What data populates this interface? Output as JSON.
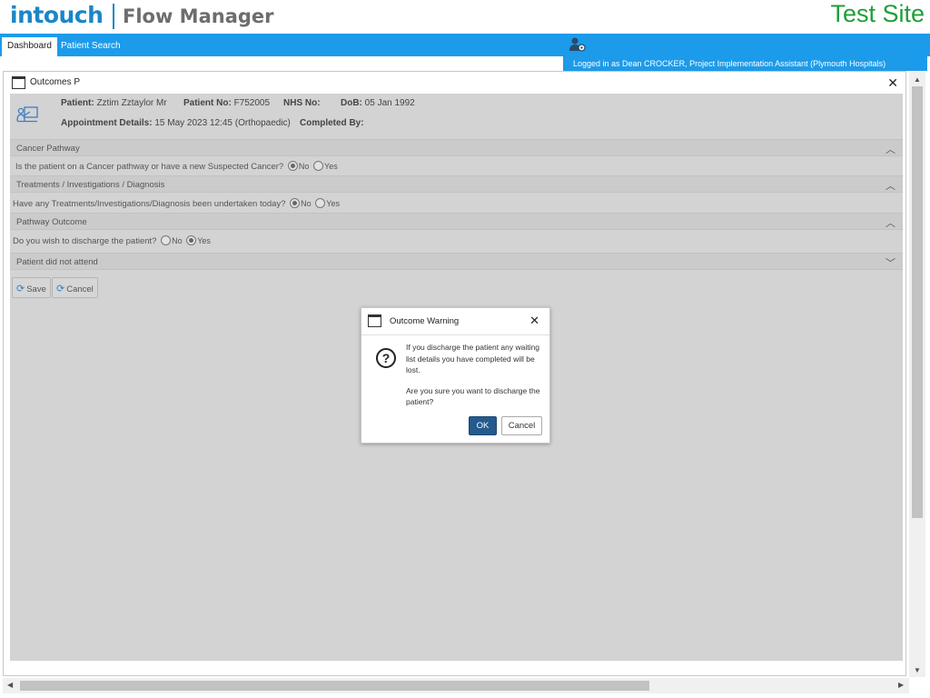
{
  "header": {
    "logo_intouch": "intouch",
    "logo_product": "Flow Manager",
    "site_label": "Test Site"
  },
  "nav": {
    "tabs": [
      {
        "label": "Dashboard",
        "active": true
      },
      {
        "label": "Patient Search",
        "active": false
      }
    ],
    "logged_in": "Logged in as Dean CROCKER, Project Implementation Assistant (Plymouth Hospitals)"
  },
  "window": {
    "title": "Outcomes P",
    "patient": {
      "patient_label": "Patient:",
      "patient_value": "Zztim Zztaylor Mr",
      "patient_no_label": "Patient No:",
      "patient_no_value": "F752005",
      "nhs_label": "NHS No:",
      "nhs_value": "",
      "dob_label": "DoB:",
      "dob_value": "05 Jan 1992",
      "appt_label": "Appointment Details:",
      "appt_value": "15 May 2023 12:45 (Orthopaedic)",
      "completed_label": "Completed By:",
      "completed_value": ""
    },
    "sections": {
      "cancer": {
        "title": "Cancer Pathway",
        "question": "Is the patient on a Cancer pathway or have a new Suspected Cancer?",
        "no": "No",
        "yes": "Yes",
        "selected": "No"
      },
      "treatments": {
        "title": "Treatments / Investigations / Diagnosis",
        "question": "Have any Treatments/Investigations/Diagnosis been undertaken today?",
        "no": "No",
        "yes": "Yes",
        "selected": "No"
      },
      "pathway": {
        "title": "Pathway Outcome",
        "question": "Do you wish to discharge the patient?",
        "no": "No",
        "yes": "Yes",
        "selected": "Yes"
      },
      "dna": {
        "title": "Patient did not attend"
      }
    },
    "buttons": {
      "save": "Save",
      "cancel": "Cancel"
    }
  },
  "dialog": {
    "title": "Outcome Warning",
    "message_1": "If you discharge the patient any waiting list details you have completed will be lost.",
    "message_2": "Are you sure you want to discharge the patient?",
    "ok": "OK",
    "cancel": "Cancel"
  },
  "colors": {
    "brand_blue": "#1a86c8",
    "nav_blue": "#1c9bea",
    "test_site_green": "#1f9e3a",
    "ok_button": "#245a8d"
  }
}
